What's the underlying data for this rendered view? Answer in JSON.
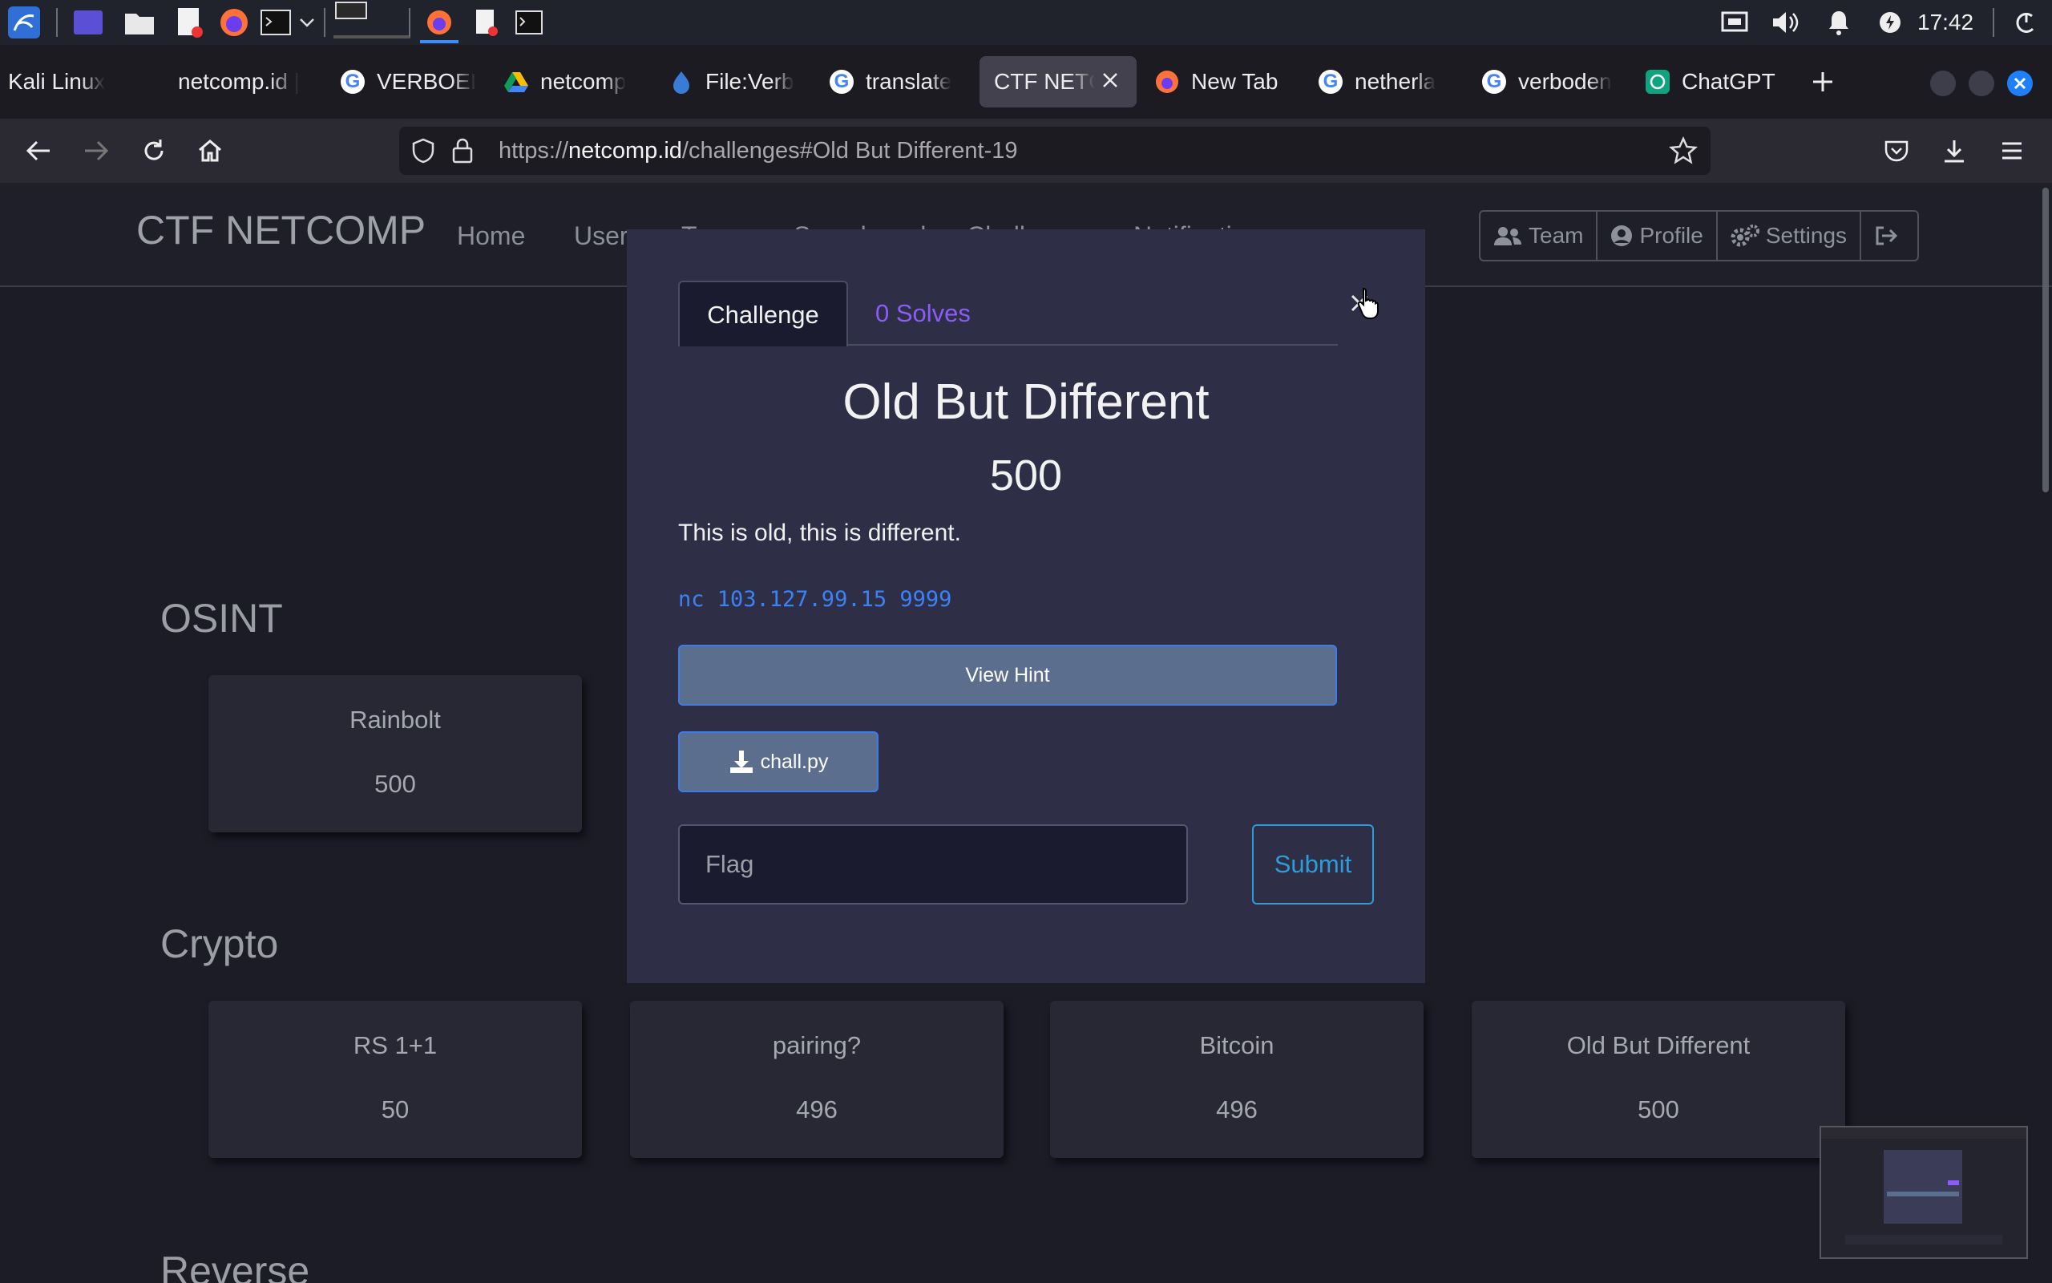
{
  "panel": {
    "clock": "17:42"
  },
  "tabs": [
    {
      "label": "Kali Linux",
      "icon": "kali-icon"
    },
    {
      "label": "netcomp.id |",
      "icon": "none"
    },
    {
      "label": "VERBOEI",
      "icon": "google-icon"
    },
    {
      "label": "netcomp",
      "icon": "drive-icon"
    },
    {
      "label": "File:Verb",
      "icon": "wiki-icon"
    },
    {
      "label": "translate",
      "icon": "google-icon"
    },
    {
      "label": "CTF NETC",
      "icon": "none",
      "active": true
    },
    {
      "label": "New Tab",
      "icon": "firefox-icon"
    },
    {
      "label": "netherla",
      "icon": "google-icon"
    },
    {
      "label": "verboden",
      "icon": "google-icon"
    },
    {
      "label": "ChatGPT",
      "icon": "chatgpt-icon"
    }
  ],
  "url": {
    "prefix": "https://",
    "domain": "netcomp.id",
    "path": "/challenges#Old But Different-19"
  },
  "site": {
    "brand": "CTF NETCOMP",
    "nav": [
      "Home",
      "Users",
      "Teams",
      "Scoreboard",
      "Challenges",
      "Notifications"
    ],
    "buttons": {
      "team": "Team",
      "profile": "Profile",
      "settings": "Settings"
    }
  },
  "categories": [
    {
      "name": "OSINT",
      "cards": [
        {
          "name": "Rainbolt",
          "value": "500"
        }
      ]
    },
    {
      "name": "Crypto",
      "cards": [
        {
          "name": "RS 1+1",
          "value": "50"
        },
        {
          "name": "pairing?",
          "value": "496"
        },
        {
          "name": "Bitcoin",
          "value": "496"
        },
        {
          "name": "Old But Different",
          "value": "500"
        }
      ]
    },
    {
      "name": "Reverse",
      "cards": []
    }
  ],
  "modal": {
    "tab_challenge": "Challenge",
    "tab_solves": "0 Solves",
    "title": "Old But Different",
    "value": "500",
    "description": "This is old, this is different.",
    "command": "nc 103.127.99.15 9999",
    "hint_button": "View Hint",
    "file_button": "chall.py",
    "flag_placeholder": "Flag",
    "submit": "Submit"
  },
  "colors": {
    "accent_blue": "#3b82f6",
    "solves_purple": "#8b5cf6",
    "submit_cyan": "#2f9bd8",
    "modal_bg": "#2e2f47"
  }
}
